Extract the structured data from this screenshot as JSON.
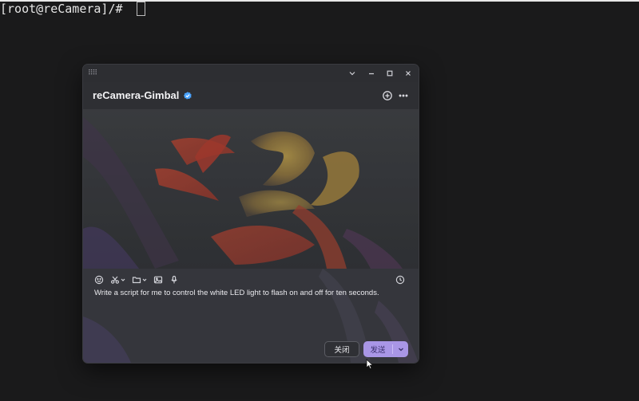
{
  "terminal": {
    "prompt": "[root@reCamera]/# "
  },
  "window": {
    "grip_icon": "grip-dots-icon",
    "controls": [
      "chevron-down-icon",
      "minimize-icon",
      "maximize-icon",
      "close-icon"
    ]
  },
  "header": {
    "title": "reCamera-Gimbal",
    "badge_icon": "verified-badge-icon",
    "actions": [
      "new-chat-icon",
      "more-icon"
    ]
  },
  "composer": {
    "tools": [
      "emoji-icon",
      "scissors-icon",
      "folder-icon",
      "image-icon",
      "microphone-icon"
    ],
    "history_icon": "history-icon",
    "text": "Write a script for me to control the white LED light to flash on and off for ten seconds.",
    "close_label": "关闭",
    "send_label": "发送"
  },
  "colors": {
    "background": "#1a1a1b",
    "window": "#2b2c30",
    "send_button": "#a996e6",
    "send_text": "#3a2f6c"
  }
}
